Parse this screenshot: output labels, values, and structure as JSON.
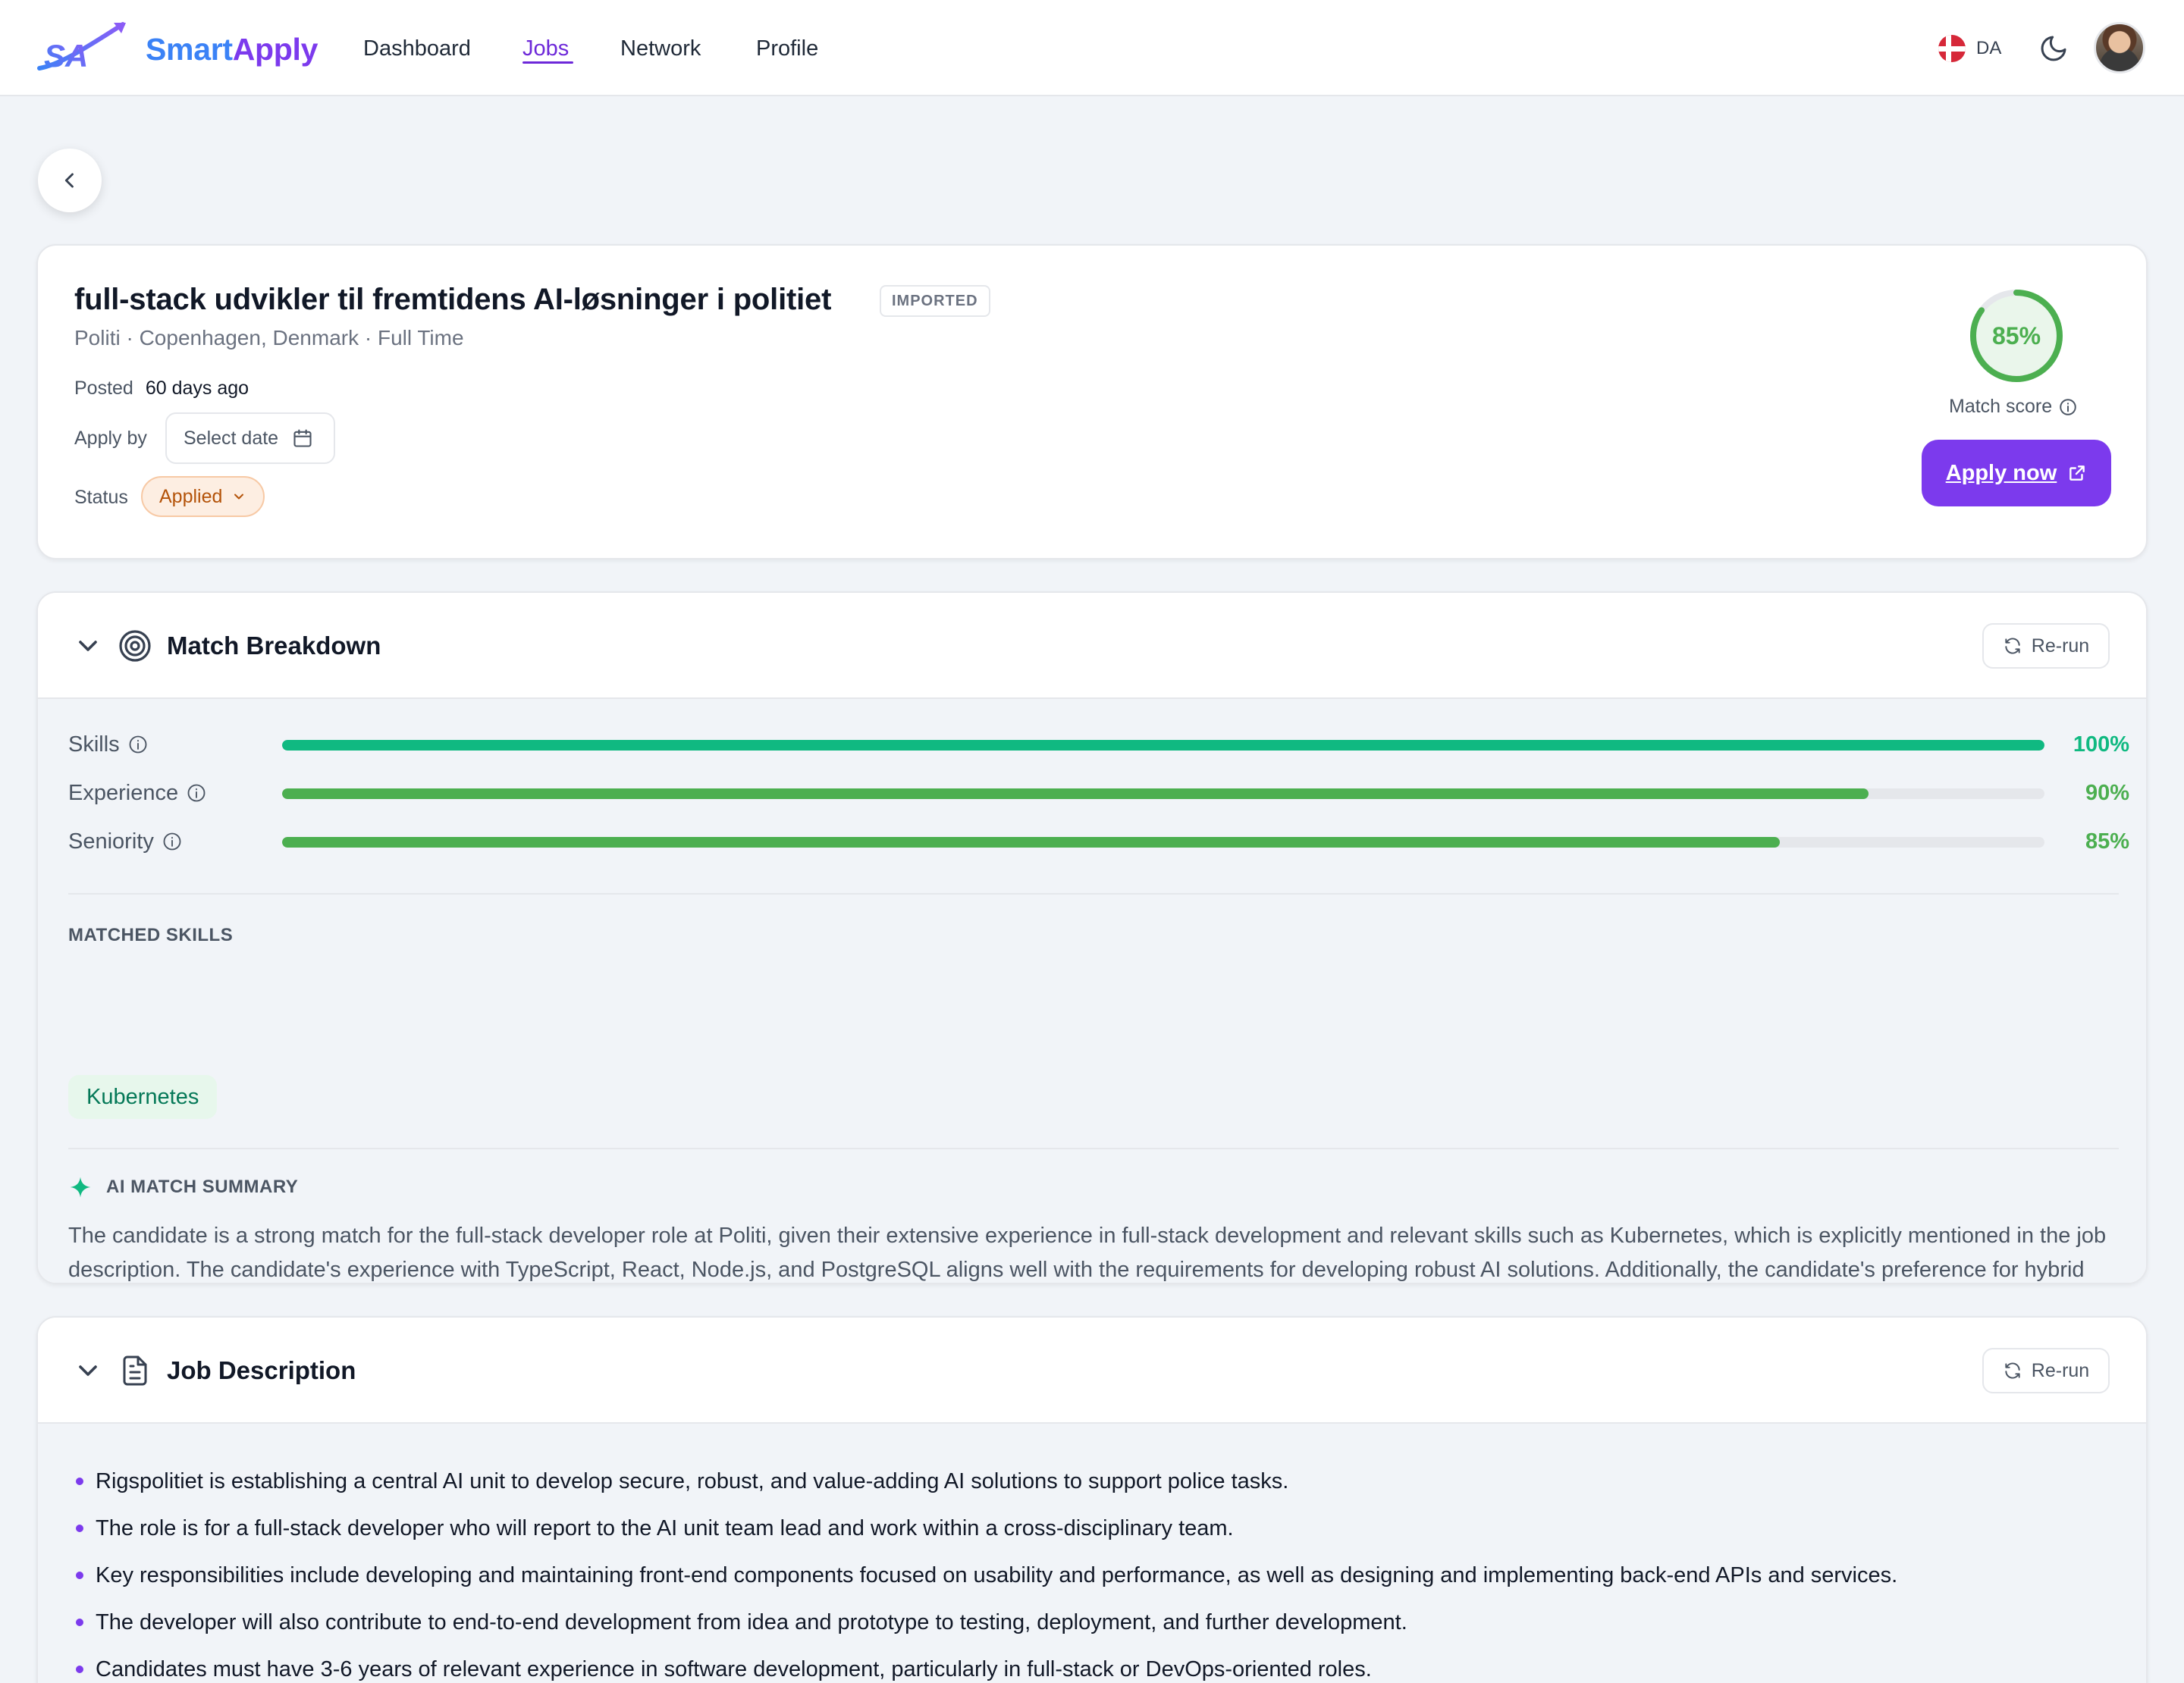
{
  "header": {
    "brand_part1": "Smart",
    "brand_part2": "Apply",
    "nav": [
      "Dashboard",
      "Jobs",
      "Network",
      "Profile"
    ],
    "active_nav": "Jobs",
    "language": "DA",
    "theme_icon": "moon-icon"
  },
  "job": {
    "title": "full-stack udvikler til fremtidens AI-løsninger i politiet",
    "badge": "IMPORTED",
    "subline": "Politi · Copenhagen, Denmark · Full Time",
    "posted_label": "Posted",
    "posted_value": "60 days ago",
    "apply_by_label": "Apply by",
    "apply_by_placeholder": "Select date",
    "status_label": "Status",
    "status_value": "Applied",
    "match_score": "85%",
    "match_score_value": 85,
    "match_score_label": "Match score",
    "apply_button": "Apply now"
  },
  "match_breakdown": {
    "title": "Match Breakdown",
    "rerun_label": "Re-run",
    "metrics": [
      {
        "label": "Skills",
        "value": 100,
        "display": "100%",
        "color": "#10b981"
      },
      {
        "label": "Experience",
        "value": 90,
        "display": "90%",
        "color": "#4caf50"
      },
      {
        "label": "Seniority",
        "value": 85,
        "display": "85%",
        "color": "#4caf50"
      }
    ],
    "matched_skills_heading": "MATCHED SKILLS",
    "matched_skills": [
      "Kubernetes"
    ],
    "ai_summary_heading": "AI MATCH SUMMARY",
    "ai_summary": "The candidate is a strong match for the full-stack developer role at Politi, given their extensive experience in full-stack development and relevant skills such as Kubernetes, which is explicitly mentioned in the job description. The candidate's experience with TypeScript, React, Node.js, and PostgreSQL aligns well with the requirements for developing robust AI solutions. Additionally, the candidate's preference for hybrid work in Copenhagen matches the job's location. The candidate's seniority and experience level are appropriate for the role, which seeks an experienced developer with a strong technical understanding and practical experience in production environments."
  },
  "job_description": {
    "title": "Job Description",
    "rerun_label": "Re-run",
    "bullets": [
      "Rigspolitiet is establishing a central AI unit to develop secure, robust, and value-adding AI solutions to support police tasks.",
      "The role is for a full-stack developer who will report to the AI unit team lead and work within a cross-disciplinary team.",
      "Key responsibilities include developing and maintaining front-end components focused on usability and performance, as well as designing and implementing back-end APIs and services.",
      "The developer will also contribute to end-to-end development from idea and prototype to testing, deployment, and further development.",
      "Candidates must have 3-6 years of relevant experience in software development, particularly in full-stack or DevOps-oriented roles."
    ]
  },
  "colors": {
    "accent": "#7c3aed",
    "brand_blue": "#3b82f6",
    "score_green": "#4caf50",
    "skills_green": "#10b981",
    "status_orange": "#b45309"
  }
}
